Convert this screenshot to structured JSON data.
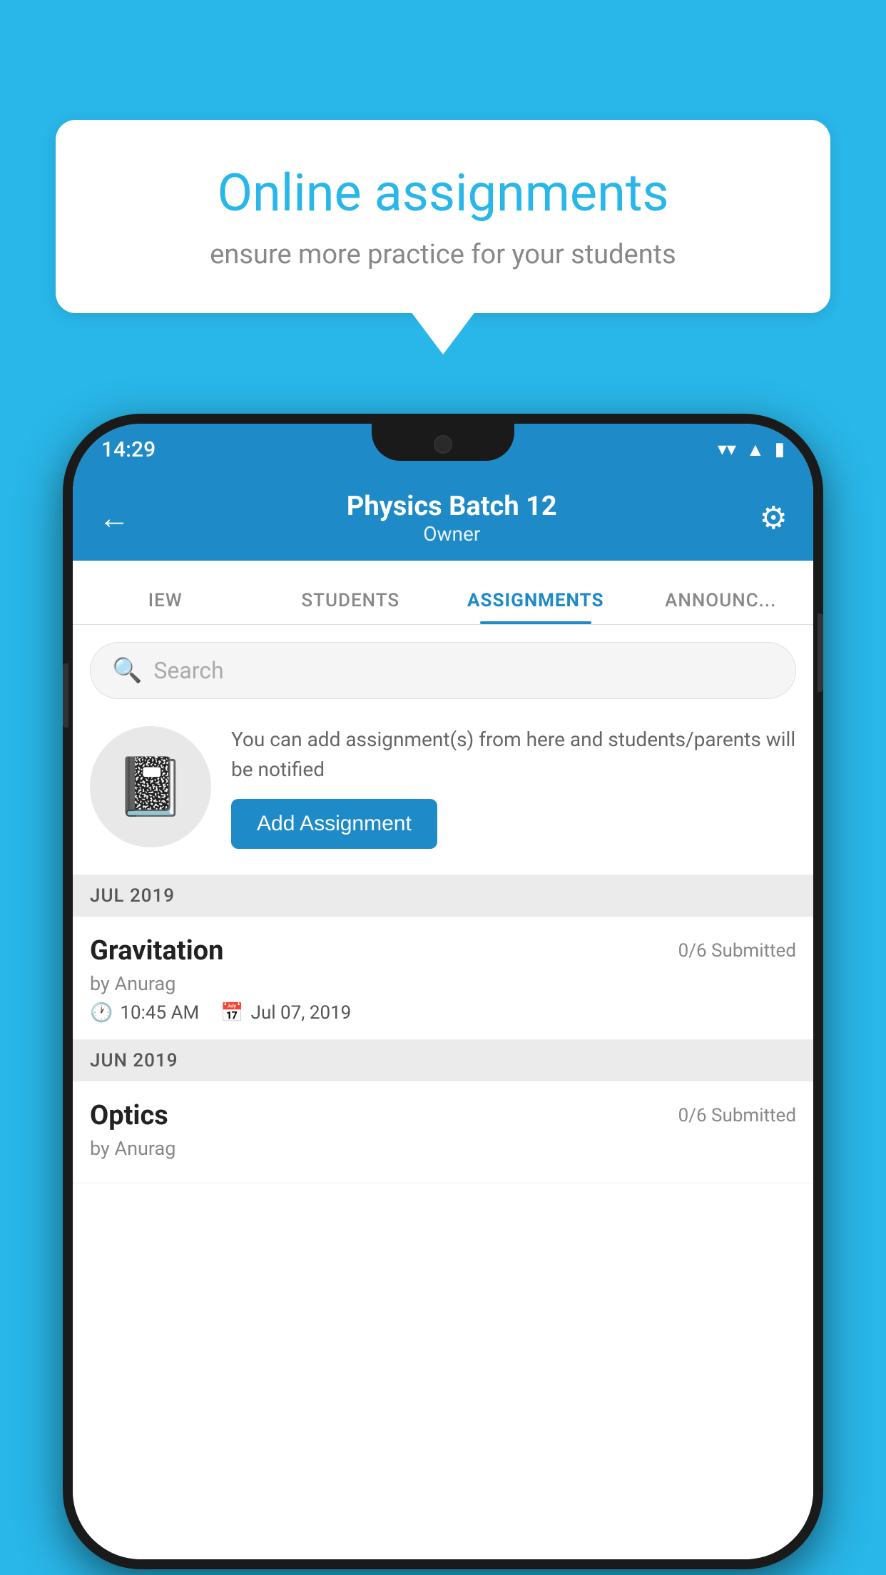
{
  "background_color": "#29b6e8",
  "speech_bubble": {
    "title": "Online assignments",
    "subtitle": "ensure more practice for your students"
  },
  "status_bar": {
    "time": "14:29",
    "wifi_icon": "▼",
    "signal_icon": "▲",
    "battery_icon": "▮"
  },
  "header": {
    "title": "Physics Batch 12",
    "subtitle": "Owner",
    "back_label": "←",
    "settings_label": "⚙"
  },
  "tabs": [
    {
      "label": "IEW",
      "active": false
    },
    {
      "label": "STUDENTS",
      "active": false
    },
    {
      "label": "ASSIGNMENTS",
      "active": true
    },
    {
      "label": "ANNOUNCEM...",
      "active": false
    }
  ],
  "search": {
    "placeholder": "Search"
  },
  "add_section": {
    "description": "You can add assignment(s) from here and students/parents will be notified",
    "button_label": "Add Assignment"
  },
  "month_groups": [
    {
      "month": "JUL 2019",
      "assignments": [
        {
          "name": "Gravitation",
          "submitted": "0/6 Submitted",
          "author": "by Anurag",
          "time": "10:45 AM",
          "date": "Jul 07, 2019"
        }
      ]
    },
    {
      "month": "JUN 2019",
      "assignments": [
        {
          "name": "Optics",
          "submitted": "0/6 Submitted",
          "author": "by Anurag",
          "time": "",
          "date": ""
        }
      ]
    }
  ]
}
